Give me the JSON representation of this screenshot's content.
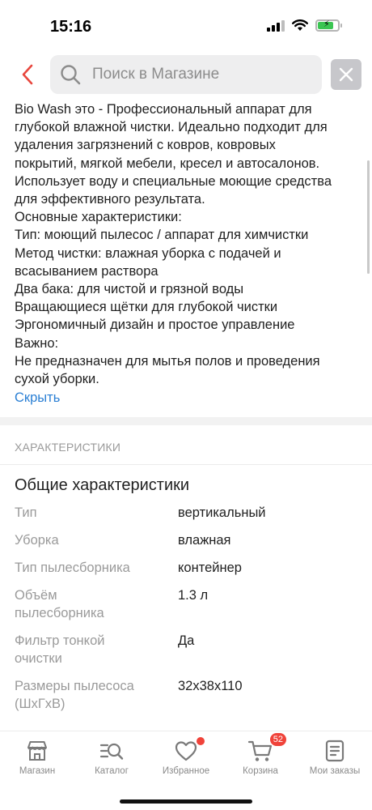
{
  "status_bar": {
    "time": "15:16"
  },
  "search": {
    "placeholder": "Поиск в Магазине"
  },
  "description": {
    "lines": [
      "Bio Wash это - Профессиональный аппарат для",
      "глубокой влажной чистки. Идеально подходит для",
      "удаления загрязнений с ковров, ковровых",
      "покрытий, мягкой мебели, кресел и автосалонов.",
      "Использует воду и специальные моющие средства",
      "для эффективного результата.",
      "Основные характеристики:",
      "Тип: моющий пылесос / аппарат для химчистки",
      "Метод чистки: влажная уборка с подачей и",
      "всасыванием раствора",
      "Два бака: для чистой и грязной воды",
      "Вращающиеся щётки для глубокой чистки",
      "Эргономичный дизайн и простое управление",
      "Важно:",
      "Не предназначен для мытья полов и проведения",
      "сухой уборки."
    ],
    "hide_label": "Скрыть"
  },
  "characteristics": {
    "section_label": "ХАРАКТЕРИСТИКИ",
    "group_title": "Общие характеристики",
    "rows": [
      {
        "key": [
          "Тип"
        ],
        "value": "вертикальный"
      },
      {
        "key": [
          "Уборка"
        ],
        "value": "влажная"
      },
      {
        "key": [
          "Тип пылесборника"
        ],
        "value": "контейнер"
      },
      {
        "key": [
          "Объём",
          "пылесборника"
        ],
        "value": "1.3 л"
      },
      {
        "key": [
          "Фильтр тонкой",
          "очистки"
        ],
        "value": "Да"
      },
      {
        "key": [
          "Размеры пылесоса",
          "(ШxГxВ)"
        ],
        "value": "32x38x110"
      }
    ]
  },
  "tab_bar": {
    "tabs": [
      {
        "label": "Магазин",
        "icon": "store-icon"
      },
      {
        "label": "Каталог",
        "icon": "catalog-search-icon"
      },
      {
        "label": "Избранное",
        "icon": "heart-icon"
      },
      {
        "label": "Корзина",
        "icon": "cart-icon"
      },
      {
        "label": "Мои заказы",
        "icon": "orders-icon"
      }
    ],
    "cart_count": "52"
  },
  "colors": {
    "accent_red": "#e8473e",
    "link_blue": "#2a7fd4",
    "muted_gray": "#9a9a9a",
    "battery_green": "#3bc552"
  }
}
